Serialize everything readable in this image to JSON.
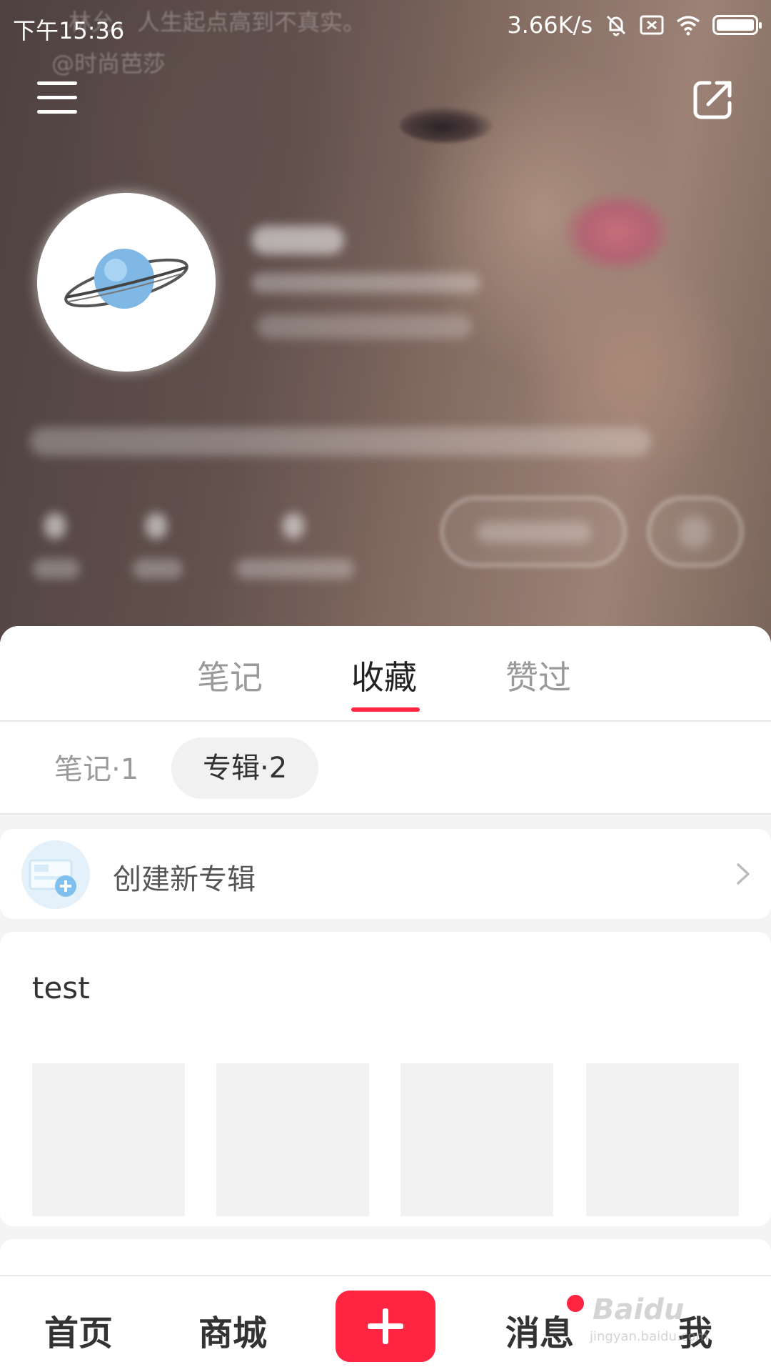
{
  "status_bar": {
    "time": "下午15:36",
    "network_speed": "3.66K/s"
  },
  "header": {
    "ghost_caption": "林允，人生起点高到不真实。",
    "ghost_credit": "@时尚芭莎"
  },
  "main_tabs": [
    {
      "label": "笔记",
      "active": false
    },
    {
      "label": "收藏",
      "active": true
    },
    {
      "label": "赞过",
      "active": false
    }
  ],
  "sub_tabs": [
    {
      "label": "笔记·1",
      "active": false
    },
    {
      "label": "专辑·2",
      "active": true
    }
  ],
  "create_album": {
    "label": "创建新专辑"
  },
  "albums": [
    {
      "title": "test"
    }
  ],
  "bottom_nav": {
    "home": "首页",
    "mall": "商城",
    "messages": "消息",
    "me": "我",
    "watermark": "Baidu",
    "watermark_sub": "jingyan.baidu.com"
  },
  "colors": {
    "accent": "#ff2442"
  }
}
